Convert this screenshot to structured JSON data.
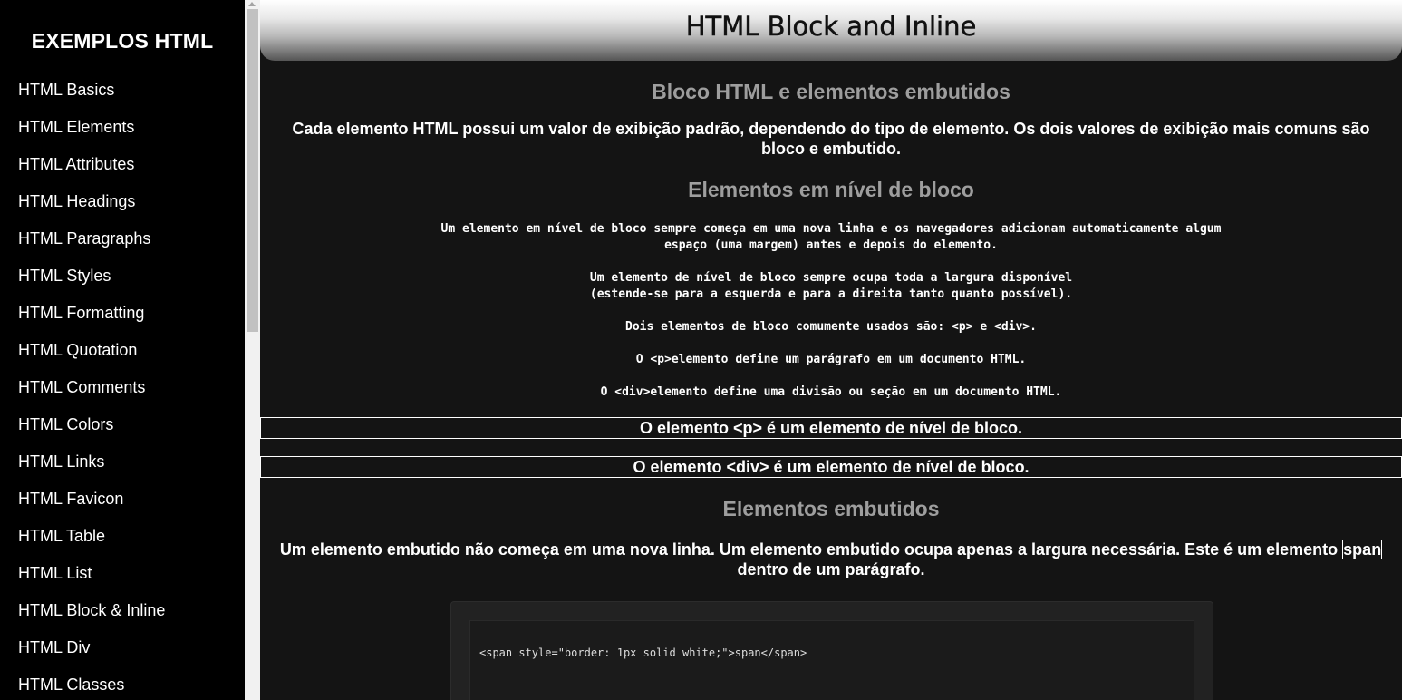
{
  "sidebar": {
    "title": "EXEMPLOS HTML",
    "items": [
      {
        "label": "HTML Basics"
      },
      {
        "label": "HTML Elements"
      },
      {
        "label": "HTML Attributes"
      },
      {
        "label": "HTML Headings"
      },
      {
        "label": "HTML Paragraphs"
      },
      {
        "label": "HTML Styles"
      },
      {
        "label": "HTML Formatting"
      },
      {
        "label": "HTML Quotation"
      },
      {
        "label": "HTML Comments"
      },
      {
        "label": "HTML Colors"
      },
      {
        "label": "HTML Links"
      },
      {
        "label": "HTML Favicon"
      },
      {
        "label": "HTML Table"
      },
      {
        "label": "HTML List"
      },
      {
        "label": "HTML Block & Inline"
      },
      {
        "label": "HTML Div"
      },
      {
        "label": "HTML Classes"
      }
    ]
  },
  "header": {
    "title": "HTML Block and Inline"
  },
  "content": {
    "section1": {
      "title": "Bloco HTML e elementos embutidos",
      "text": "Cada elemento HTML possui um valor de exibição padrão, dependendo do tipo de elemento. Os dois valores de exibição mais comuns são bloco e embutido."
    },
    "section2": {
      "title": "Elementos em nível de bloco",
      "pre_line1": "Um elemento em nível de bloco sempre começa em uma nova linha e os navegadores adicionam automaticamente algum",
      "pre_line2": "espaço (uma margem) antes e depois do elemento.",
      "pre_line3": "Um elemento de nível de bloco sempre ocupa toda a largura disponível",
      "pre_line4": "(estende-se para a esquerda e para a direita tanto quanto possível).",
      "pre_line5": "Dois elementos de bloco comumente usados são: <p> e <div>.",
      "pre_line6": "O <p>elemento define um parágrafo em um documento HTML.",
      "pre_line7": "O <div>elemento define uma divisão ou seção em um documento HTML.",
      "p_demo": "O elemento <p> é um elemento de nível de bloco.",
      "div_demo": "O elemento <div> é um elemento de nível de bloco."
    },
    "section3": {
      "title": "Elementos embutidos",
      "text_before": "Um elemento embutido não começa em uma nova linha. Um elemento embutido ocupa apenas a largura necessária. Este é um elemento ",
      "span_word": "span",
      "text_after": " dentro de um parágrafo.",
      "code": "<span style=\"border: 1px solid white;\">span</span>"
    }
  }
}
